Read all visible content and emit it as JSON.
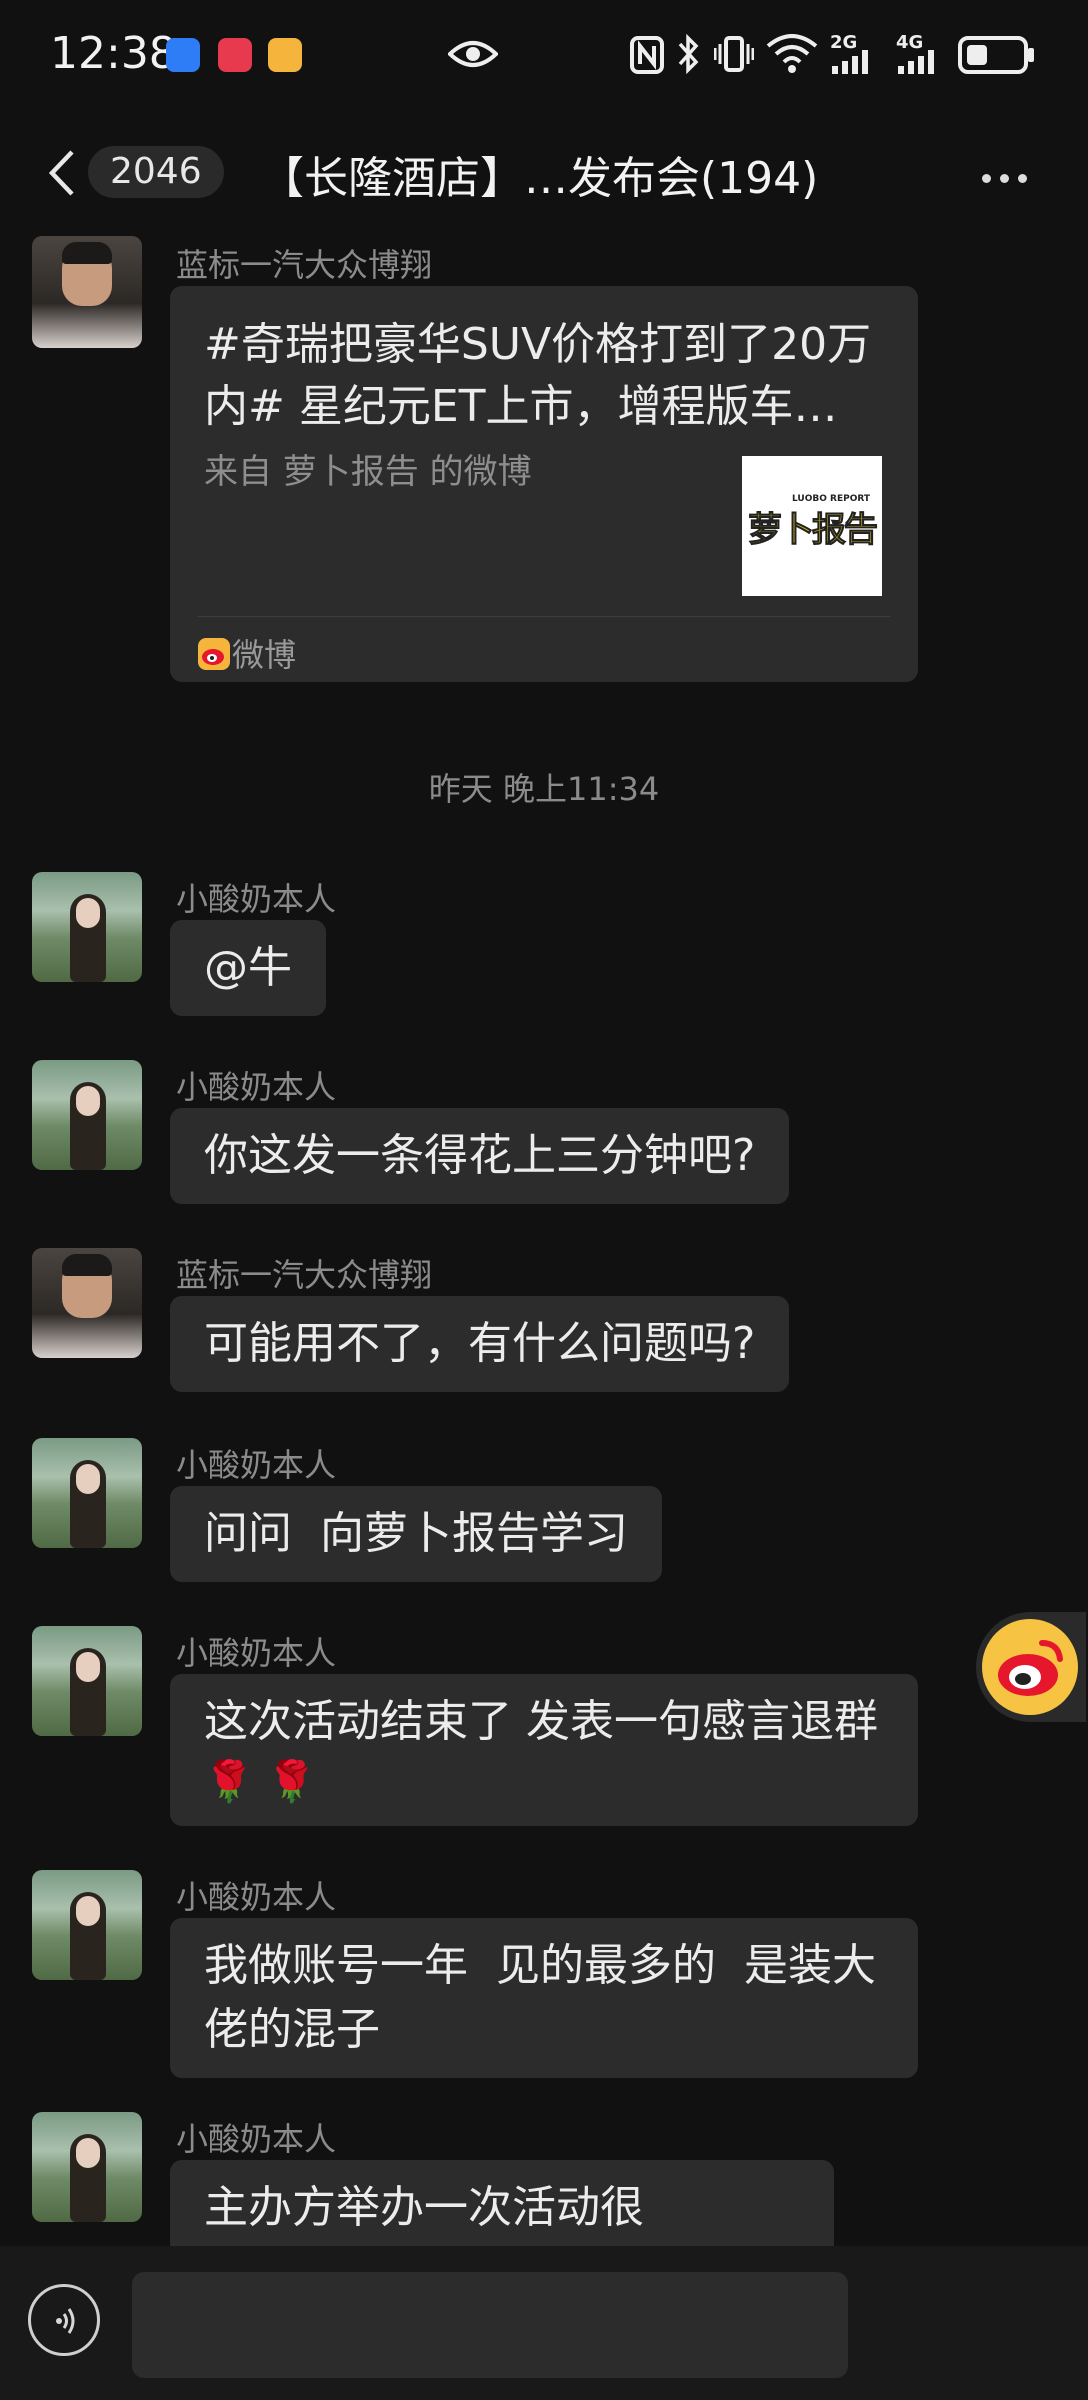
{
  "status_bar": {
    "time": "12:38",
    "network_2g": "2G",
    "network_4g": "4G"
  },
  "header": {
    "back_icon": "chevron-left-icon",
    "unread_badge": "2046",
    "title": "【长隆酒店】…发布会(194)",
    "more_icon": "more-dots-icon"
  },
  "share_card": {
    "sender": "蓝标一汽大众博翔",
    "title": "#奇瑞把豪华SUV价格打到了20万内# 星纪元ET上市，增程版车…",
    "subtitle": "来自 萝卜报告 的微博",
    "source": "微博",
    "thumb_text": "萝卜报告",
    "thumb_subtext": "LUOBO REPORT"
  },
  "timestamp": "昨天 晚上11:34",
  "messages": [
    {
      "sender": "小酸奶本人",
      "text": "@牛"
    },
    {
      "sender": "小酸奶本人",
      "text": "你这发一条得花上三分钟吧?"
    },
    {
      "sender": "蓝标一汽大众博翔",
      "text": "可能用不了，有什么问题吗?"
    },
    {
      "sender": "小酸奶本人",
      "text": "问问  向萝卜报告学习"
    },
    {
      "sender": "小酸奶本人",
      "text": "这次活动结束了 发表一句感言退群",
      "line2": "🌹 🌹"
    },
    {
      "sender": "小酸奶本人",
      "text": "我做账号一年  见的最多的  是装大佬的混子"
    },
    {
      "sender": "小酸奶本人",
      "text": "主办方举办一次活动很"
    }
  ],
  "colors": {
    "background": "#111111",
    "bubble": "#2c2c2c",
    "weibo_red": "#e6162d",
    "weibo_yellow": "#f5b43b"
  }
}
